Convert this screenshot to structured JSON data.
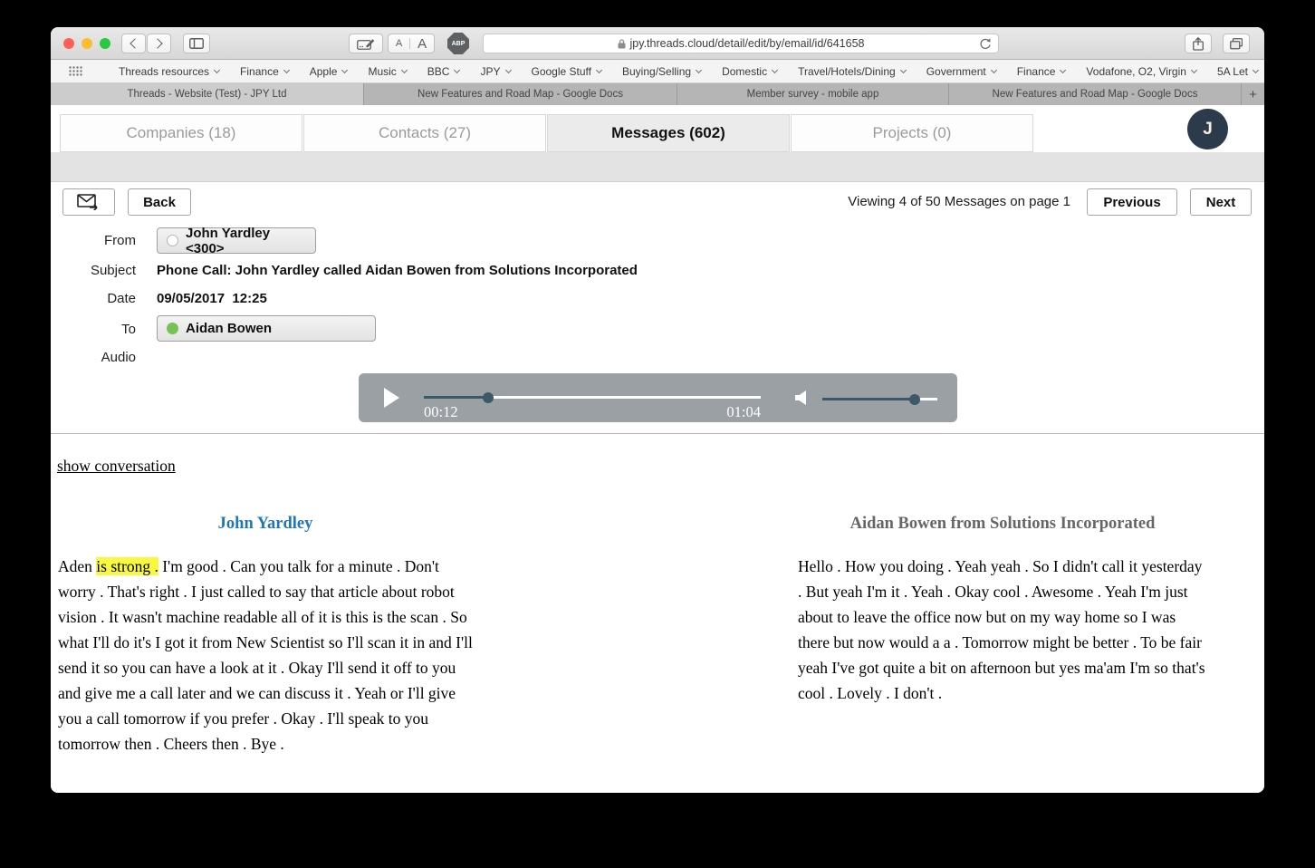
{
  "browser": {
    "url": "jpy.threads.cloud/detail/edit/by/email/id/641658",
    "adblock_label": "ABP",
    "font_buttons": [
      "A",
      "A"
    ],
    "new_tab_label": "+",
    "bookmarks": [
      "Threads resources",
      "Finance",
      "Apple",
      "Music",
      "BBC",
      "JPY",
      "Google Stuff",
      "Buying/Selling",
      "Domestic",
      "Travel/Hotels/Dining",
      "Government",
      "Finance",
      "Vodafone, O2, Virgin",
      "5A Let"
    ],
    "tabs": [
      "Threads - Website (Test) - JPY Ltd",
      "New Features and Road Map - Google Docs",
      "Member survey - mobile app",
      "New Features and Road Map - Google Docs"
    ]
  },
  "app": {
    "tabs": [
      "Companies  (18)",
      "Contacts  (27)",
      "Messages (602)",
      "Projects  (0)"
    ],
    "active_tab": "Messages (602)",
    "avatar_initial": "J",
    "toolbar": {
      "back_label": "Back",
      "viewing_text": "Viewing 4 of 50 Messages on page 1",
      "previous_label": "Previous",
      "next_label": "Next"
    },
    "message": {
      "from_label": "From",
      "from_value": "John Yardley <300>",
      "subject_label": "Subject",
      "subject_value": "Phone Call: John Yardley called Aidan Bowen from Solutions Incorporated",
      "date_label": "Date",
      "date_value": "09/05/2017",
      "time_value": "12:25",
      "to_label": "To",
      "to_value": "Aidan Bowen",
      "audio_label": "Audio"
    },
    "audio": {
      "elapsed": "00:12",
      "duration": "01:04",
      "progress_percent": 19,
      "volume_percent": 80
    },
    "conversation": {
      "show_link": "show conversation",
      "left": {
        "header": "John Yardley",
        "text_prefix": "Aden ",
        "highlight": "is strong .",
        "text_rest": " I'm good . Can you talk for a minute . Don't worry . That's right . I just called to say that article about robot vision . It wasn't machine readable all of it is this is the scan . So what I'll do it's I got it from New Scientist so I'll scan it in and I'll send it so you can have a look at it . Okay I'll send it off to you and give me a call later and we can discuss it . Yeah or I'll give you a call tomorrow if you prefer . Okay . I'll speak to you tomorrow then . Cheers then . Bye ."
      },
      "right": {
        "header": "Aidan Bowen from Solutions Incorporated",
        "text": "Hello . How you doing . Yeah yeah . So I didn't call it yesterday . But yeah I'm it . Yeah . Okay cool . Awesome . Yeah I'm just about to leave the office now but on my way home so I was there but now would a a . Tomorrow might be better . To be fair yeah I've got quite a bit on afternoon but yes ma'am I'm so that's cool . Lovely . I don't ."
      }
    }
  },
  "colors": {
    "highlight": "#f8f840",
    "left_header_blue": "#1f77b4",
    "right_header_grey": "#666666",
    "avatar_navy": "#2c3b4c",
    "online_green": "#76c253",
    "player_grey": "#9aa0a3",
    "slider_dark": "#3d5866"
  }
}
